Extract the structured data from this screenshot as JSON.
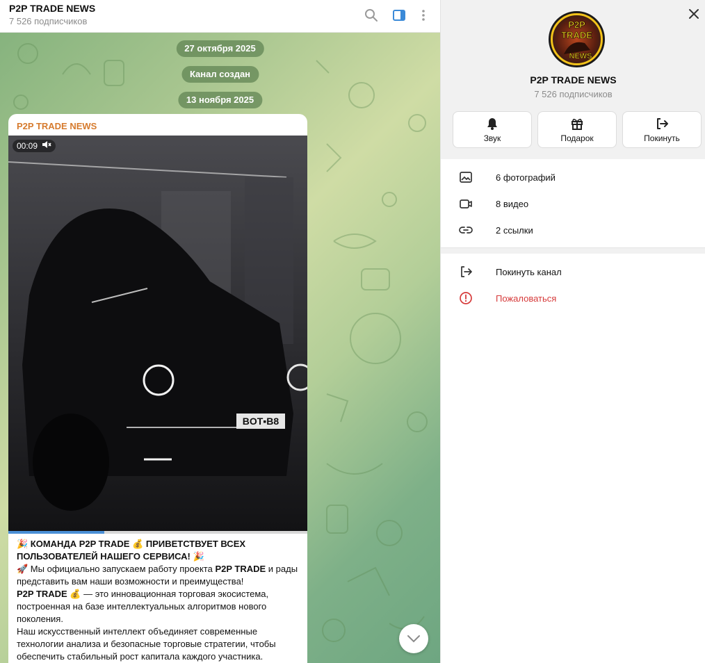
{
  "chat": {
    "title": "P2P TRADE NEWS",
    "subtitle": "7 526 подписчиков",
    "dates": [
      "27 октября 2025",
      "Канал создан",
      "13 ноября 2025"
    ],
    "message": {
      "author": "P2P TRADE NEWS",
      "video_time": "00:09",
      "video_progress": 0.32,
      "plate_text": "BOT▪B8",
      "lines": {
        "l1a": "🎉 КОМАНДА P2P TRADE 💰 ПРИВЕТСТВУЕТ ВСЕХ",
        "l1b": "ПОЛЬЗОВАТЕЛЕЙ НАШЕГО СЕРВИСА! 🎉",
        "l2_pre": "🚀 Мы официально запускаем работу проекта ",
        "l2_bold": "P2P TRADE",
        "l2_post": " и рады представить вам наши возможности и преимущества!",
        "l3_bold": "P2P TRADE",
        "l3_post": " 💰 — это инновационная торговая экосистема, построенная на базе интеллектуальных алгоритмов нового поколения.",
        "l4": "Наш искусственный интеллект объединяет современные технологии анализа и безопасные торговые стратегии, чтобы обеспечить стабильный рост капитала каждого участника."
      }
    }
  },
  "panel": {
    "name": "P2P TRADE NEWS",
    "subtitle": "7 526 подписчиков",
    "avatar_text": [
      "P2P",
      "TRADE",
      "NEWS"
    ],
    "actions": [
      {
        "label": "Звук",
        "icon": "bell-icon"
      },
      {
        "label": "Подарок",
        "icon": "gift-icon"
      },
      {
        "label": "Покинуть",
        "icon": "leave-icon"
      }
    ],
    "media": [
      {
        "label": "6 фотографий",
        "icon": "photo-icon"
      },
      {
        "label": "8 видео",
        "icon": "video-icon"
      },
      {
        "label": "2 ссылки",
        "icon": "link-icon"
      }
    ],
    "leave_channel": "Покинуть канал",
    "report": "Пожаловаться"
  },
  "colors": {
    "accent": "#4a8fd6",
    "author": "#d67b2e",
    "danger": "#d63a3a"
  }
}
